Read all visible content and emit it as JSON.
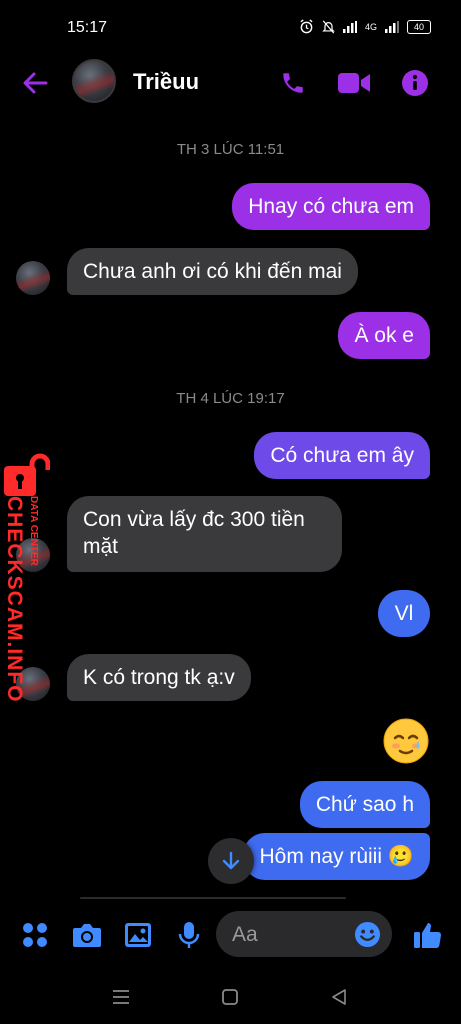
{
  "status_bar": {
    "time": "15:17",
    "network_label": "4G",
    "battery": "40"
  },
  "header": {
    "contact_name": "Triềuu",
    "back_icon": "arrow-left-icon",
    "call_icon": "phone-icon",
    "video_icon": "video-camera-icon",
    "info_icon": "info-icon"
  },
  "conversation": {
    "timestamps": [
      "TH 3 LÚC 11:51",
      "TH 4 LÚC 19:17"
    ],
    "messages": [
      {
        "sender": "me",
        "text": "Hnay có chưa em"
      },
      {
        "sender": "contact",
        "text": "Chưa anh ơi có khi đến mai"
      },
      {
        "sender": "me",
        "text": "À ok e"
      },
      {
        "sender": "me",
        "text": "Có chưa em ây"
      },
      {
        "sender": "contact",
        "text": "Con vừa lấy đc 300 tiền"
      },
      {
        "sender": "contact",
        "text": "mặt"
      },
      {
        "sender": "me",
        "text": "Vl"
      },
      {
        "sender": "contact",
        "text": "K có trong tk ạ:v"
      },
      {
        "sender": "me",
        "text": "🥲",
        "type": "emoji"
      },
      {
        "sender": "me",
        "text": "Chứ sao h"
      },
      {
        "sender": "me",
        "text": "Hôm nay rùiii 🥲"
      }
    ]
  },
  "watermark": {
    "brand": "CHECKSCAM.INFO",
    "tagline": "DATA CENTER"
  },
  "composer": {
    "placeholder": "Aa",
    "icons": [
      "apps-icon",
      "camera-icon",
      "gallery-icon",
      "microphone-icon",
      "emoji-icon",
      "thumbs-up-icon"
    ]
  },
  "colors": {
    "accent_purple": "#9b30e6",
    "accent_blue": "#3f6bf0",
    "incoming_bubble": "#3a3a3c",
    "watermark_red": "#ff2a2a"
  }
}
